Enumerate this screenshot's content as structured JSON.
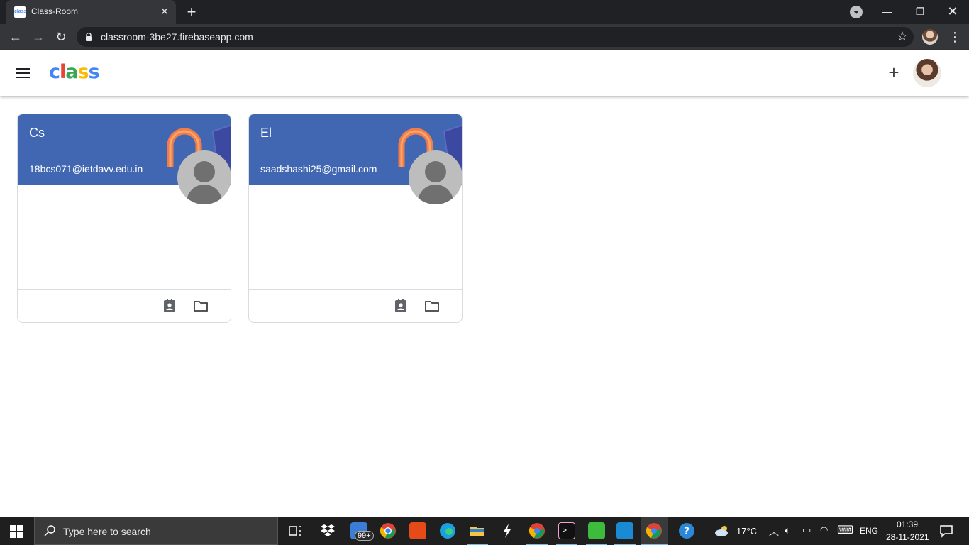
{
  "browser": {
    "tab_title": "Class-Room",
    "tab_favicon_text": "class",
    "url": "classroom-3be27.firebaseapp.com"
  },
  "app": {
    "logo_text": [
      "c",
      "l",
      "a",
      "s",
      "s"
    ]
  },
  "classes": [
    {
      "name": "Cs",
      "owner_email": "18bcs071@ietdavv.edu.in"
    },
    {
      "name": "El",
      "owner_email": "saadshashi25@gmail.com"
    }
  ],
  "taskbar": {
    "search_placeholder": "Type here to search",
    "mail_badge": "99+",
    "temperature": "17°C",
    "language": "ENG",
    "time": "01:39",
    "date": "28-11-2021"
  }
}
